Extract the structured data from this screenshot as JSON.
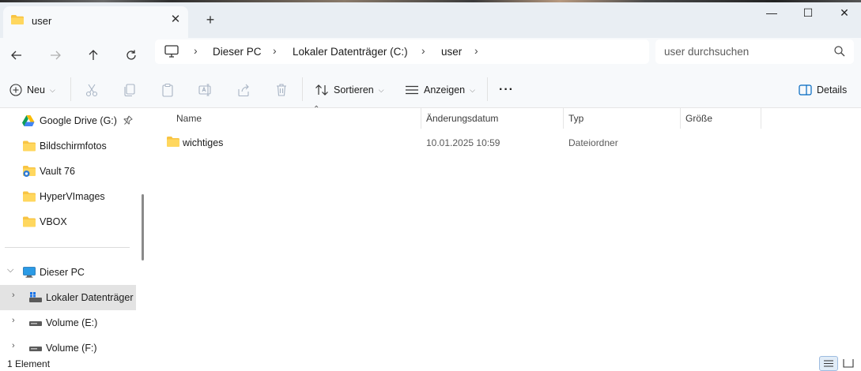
{
  "window": {
    "tab_title": "user",
    "new_tab_label": "+",
    "close_tab_label": "✕",
    "minimize_label": "—",
    "maximize_label": "☐",
    "close_label": "✕"
  },
  "nav": {
    "breadcrumbs": [
      "Dieser PC",
      "Lokaler Datenträger (C:)",
      "user"
    ],
    "search_placeholder": "user durchsuchen"
  },
  "commands": {
    "new_label": "Neu",
    "sort_label": "Sortieren",
    "view_label": "Anzeigen",
    "more_label": "···",
    "details_label": "Details"
  },
  "sidebar": {
    "quick_access": [
      {
        "label": "Google Drive (G:)",
        "icon": "google-drive-icon",
        "pinned": true
      },
      {
        "label": "Bildschirmfotos",
        "icon": "folder-icon"
      },
      {
        "label": "Vault 76",
        "icon": "vault-folder-icon"
      },
      {
        "label": "HyperVImages",
        "icon": "folder-icon"
      },
      {
        "label": "VBOX",
        "icon": "folder-icon"
      }
    ],
    "this_pc": {
      "label": "Dieser PC",
      "icon": "monitor-icon",
      "expanded": true
    },
    "drives": [
      {
        "label": "Lokaler Datenträger (C:)",
        "icon": "drive-icon",
        "selected": true
      },
      {
        "label": "Volume (E:)",
        "icon": "drive-icon"
      },
      {
        "label": "Volume (F:)",
        "icon": "drive-icon"
      }
    ]
  },
  "table": {
    "columns": [
      "Name",
      "Änderungsdatum",
      "Typ",
      "Größe"
    ],
    "rows": [
      {
        "name": "wichtiges",
        "modified": "10.01.2025 10:59",
        "type": "Dateiordner",
        "size": ""
      }
    ]
  },
  "status": {
    "count_text": "1 Element"
  },
  "colors": {
    "accent": "#0067c0",
    "folder": "#f8c443",
    "chrome_bg": "#f7f9fb",
    "titlebar_bg": "#e9eef3",
    "selected_bg": "#e3e3e3"
  }
}
